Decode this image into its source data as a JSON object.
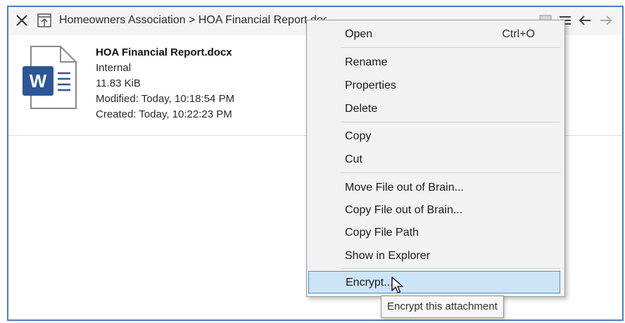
{
  "titlebar": {
    "close_icon": "close-icon",
    "upload_icon": "move-up-icon",
    "breadcrumb": "Homeowners Association > HOA Financial Report.docx",
    "view_icon": "view-icon",
    "menu_icon": "hamburger-icon",
    "back_icon": "back-arrow-icon",
    "forward_icon": "forward-arrow-icon"
  },
  "file": {
    "icon": "word-doc-icon",
    "name": "HOA Financial Report.docx",
    "location": "Internal",
    "size": "11.83 KiB",
    "modified": "Modified: Today, 10:18:54 PM",
    "created": "Created: Today, 10:22:23 PM"
  },
  "context_menu": {
    "open": "Open",
    "open_shortcut": "Ctrl+O",
    "rename": "Rename",
    "properties": "Properties",
    "delete": "Delete",
    "copy": "Copy",
    "cut": "Cut",
    "move_out": "Move File out of Brain...",
    "copy_out": "Copy File out of Brain...",
    "copy_path": "Copy File Path",
    "show_explorer": "Show in Explorer",
    "encrypt": "Encrypt..."
  },
  "tooltip": {
    "text": "Encrypt this attachment"
  },
  "colors": {
    "frame_border": "#4a7fbf",
    "highlight": "#cce4f7",
    "word_blue": "#2b5797"
  }
}
